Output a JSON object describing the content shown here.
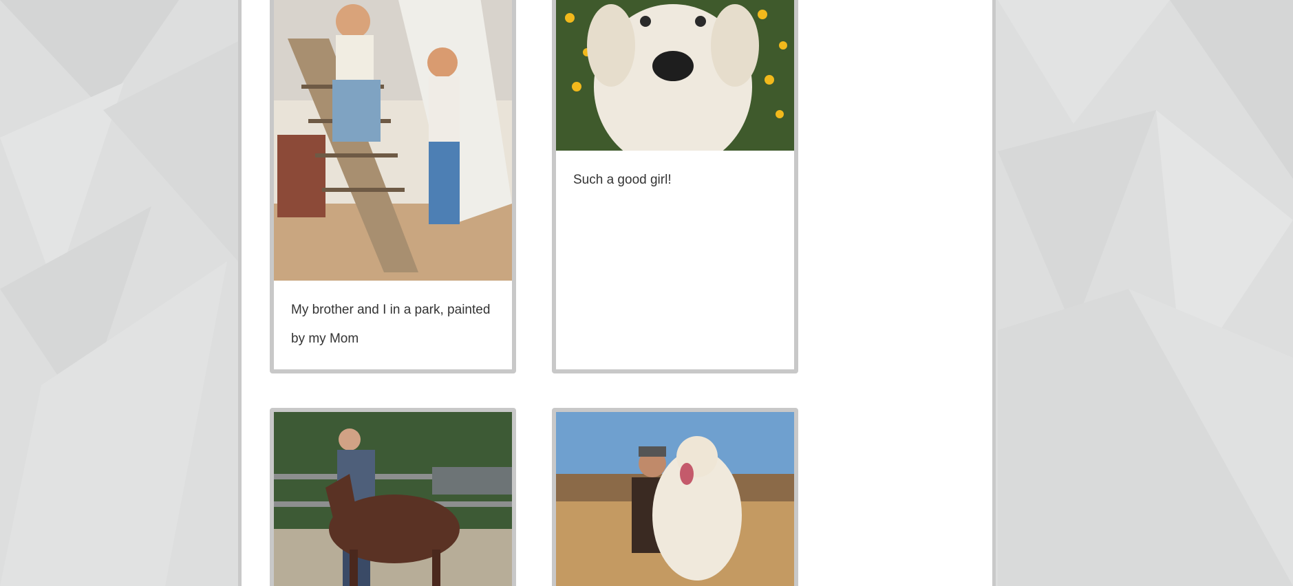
{
  "colors": {
    "background": "#dcdddd",
    "panel": "#ffffff",
    "card_border": "#c8c8c8",
    "caption_text": "#333333"
  },
  "gallery": {
    "cards": [
      {
        "image_name": "painting-children-on-slide",
        "caption": "My brother and I in a park, painted by my Mom"
      },
      {
        "image_name": "white-dog-with-flowers",
        "caption": "Such a good girl!"
      },
      {
        "image_name": "man-with-foal",
        "caption": ""
      },
      {
        "image_name": "man-hugging-white-dog",
        "caption": ""
      }
    ]
  }
}
